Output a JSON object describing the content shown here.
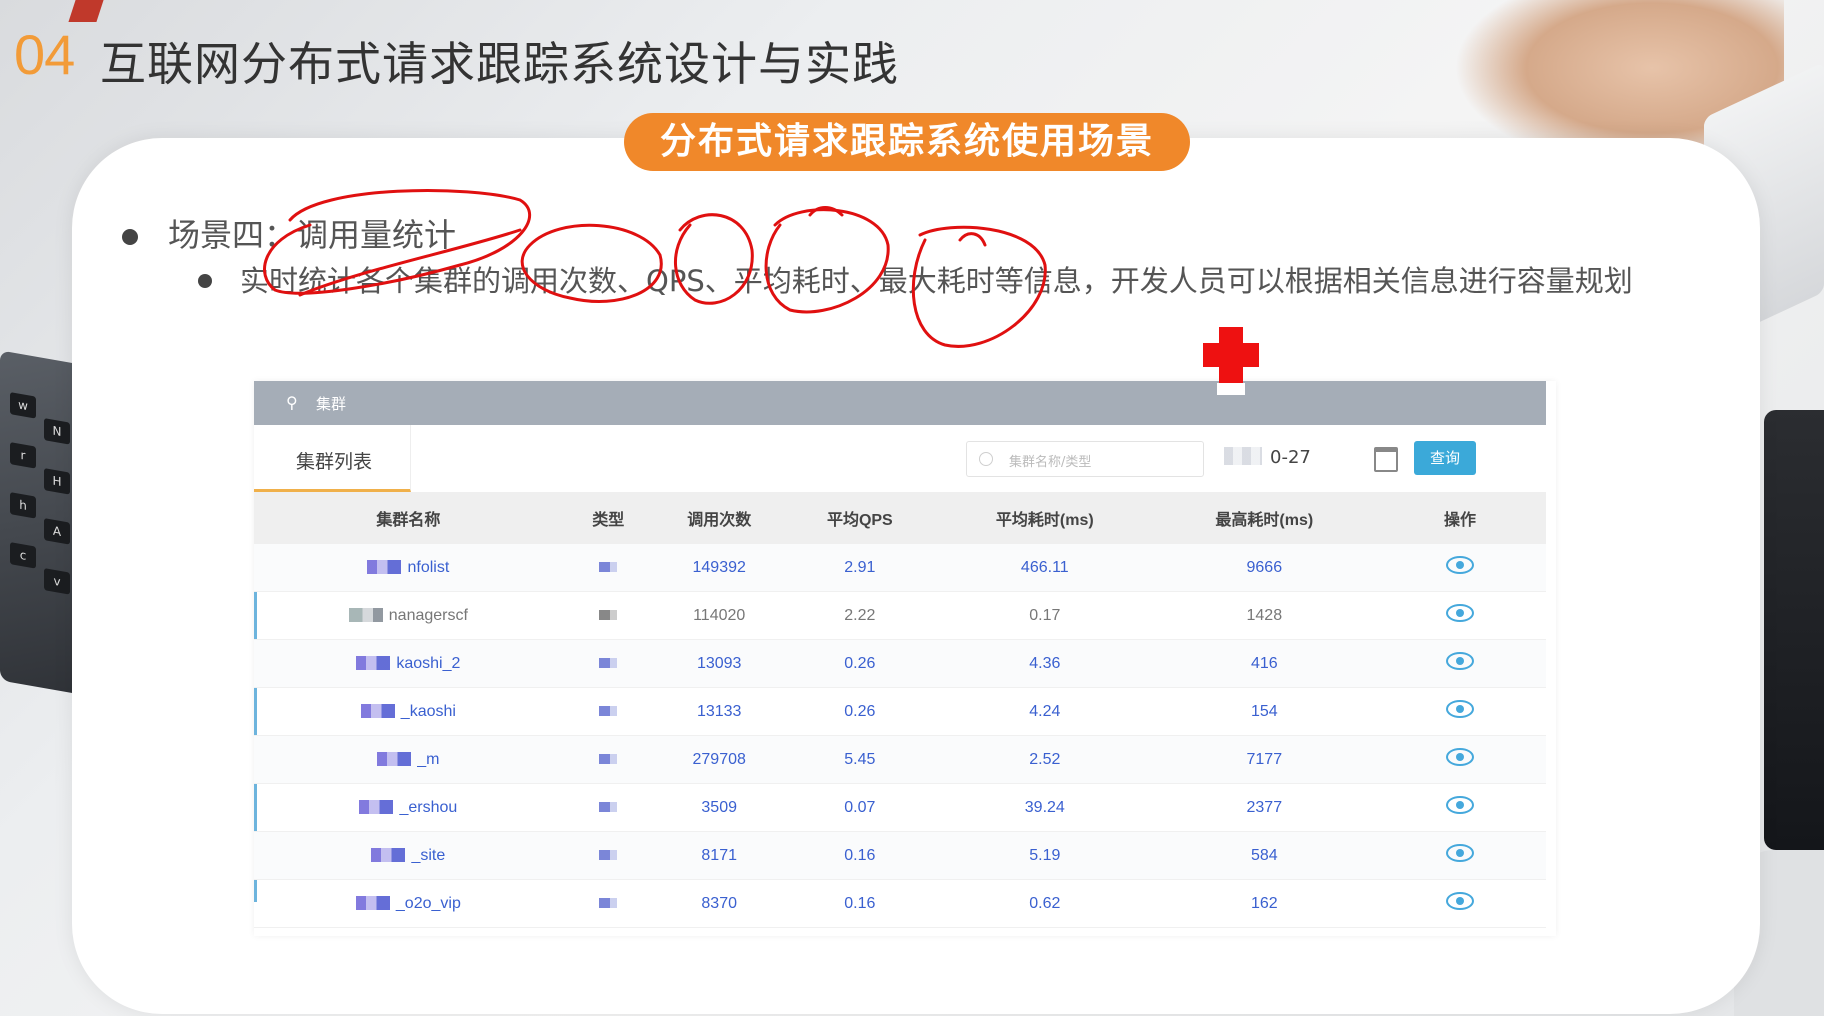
{
  "slide": {
    "number": "04",
    "title": "互联网分布式请求跟踪系统设计与实践",
    "section_pill": "分布式请求跟踪系统使用场景"
  },
  "bullets": {
    "level1": "场景四：调用量统计",
    "level2": "实时统计各个集群的调用次数、QPS、平均耗时、最大耗时等信息，开发人员可以根据相关信息进行容量规划"
  },
  "screenshot": {
    "header_label": "集群",
    "tab_label": "集群列表",
    "search_placeholder": "集群名称/类型",
    "date_value": "0-27",
    "query_button": "查询",
    "columns": [
      "集群名称",
      "类型",
      "调用次数",
      "平均QPS",
      "平均耗时(ms)",
      "最高耗时(ms)",
      "操作"
    ],
    "rows": [
      {
        "name": "nfolist",
        "calls": "149392",
        "qps": "2.91",
        "avg": "466.11",
        "max": "9666",
        "style": "blue"
      },
      {
        "name": "nanagerscf",
        "calls": "114020",
        "qps": "2.22",
        "avg": "0.17",
        "max": "1428",
        "style": "gray"
      },
      {
        "name": "kaoshi_2",
        "calls": "13093",
        "qps": "0.26",
        "avg": "4.36",
        "max": "416",
        "style": "blue"
      },
      {
        "name": "_kaoshi",
        "calls": "13133",
        "qps": "0.26",
        "avg": "4.24",
        "max": "154",
        "style": "blue"
      },
      {
        "name": "_m",
        "calls": "279708",
        "qps": "5.45",
        "avg": "2.52",
        "max": "7177",
        "style": "blue"
      },
      {
        "name": "_ershou",
        "calls": "3509",
        "qps": "0.07",
        "avg": "39.24",
        "max": "2377",
        "style": "blue"
      },
      {
        "name": "_site",
        "calls": "8171",
        "qps": "0.16",
        "avg": "5.19",
        "max": "584",
        "style": "blue"
      },
      {
        "name": "_o2o_vip",
        "calls": "8370",
        "qps": "0.16",
        "avg": "0.62",
        "max": "162",
        "style": "blue"
      }
    ]
  },
  "colors": {
    "accent_orange": "#f0882a",
    "annotation_red": "#e01010",
    "link_blue": "#3a60d0",
    "query_button": "#3ba9d9"
  }
}
